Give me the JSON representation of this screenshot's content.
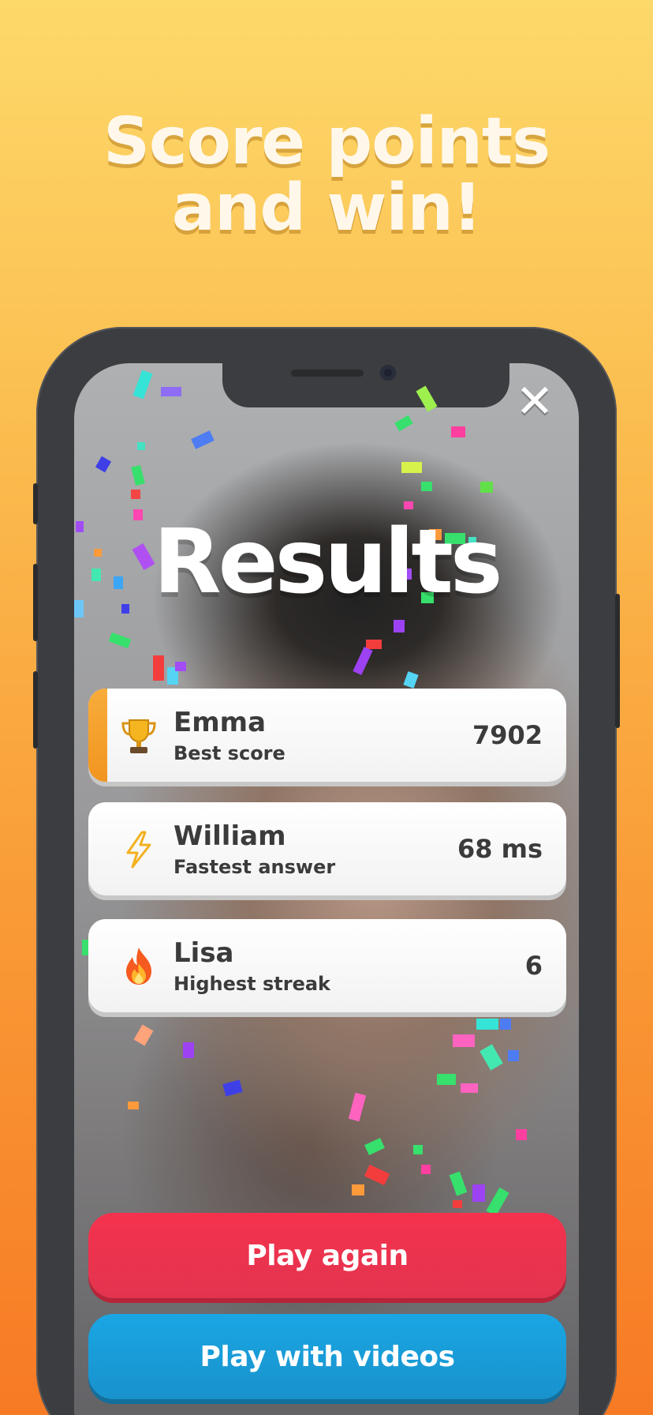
{
  "headline": {
    "line1": "Score points",
    "line2": "and win!"
  },
  "screen": {
    "title": "Results",
    "close_icon": "close-icon",
    "results": [
      {
        "name": "Emma",
        "label": "Best score",
        "value": "7902",
        "icon": "trophy-icon",
        "highlighted": true
      },
      {
        "name": "William",
        "label": "Fastest answer",
        "value": "68 ms",
        "icon": "lightning-icon",
        "highlighted": false
      },
      {
        "name": "Lisa",
        "label": "Highest streak",
        "value": "6",
        "icon": "fire-icon",
        "highlighted": false
      }
    ],
    "buttons": {
      "play_again": "Play again",
      "play_videos": "Play with videos"
    }
  },
  "colors": {
    "accent_orange": "#f1951f",
    "play_again_red": "#f5324e",
    "play_videos_blue": "#1aa6e4"
  }
}
